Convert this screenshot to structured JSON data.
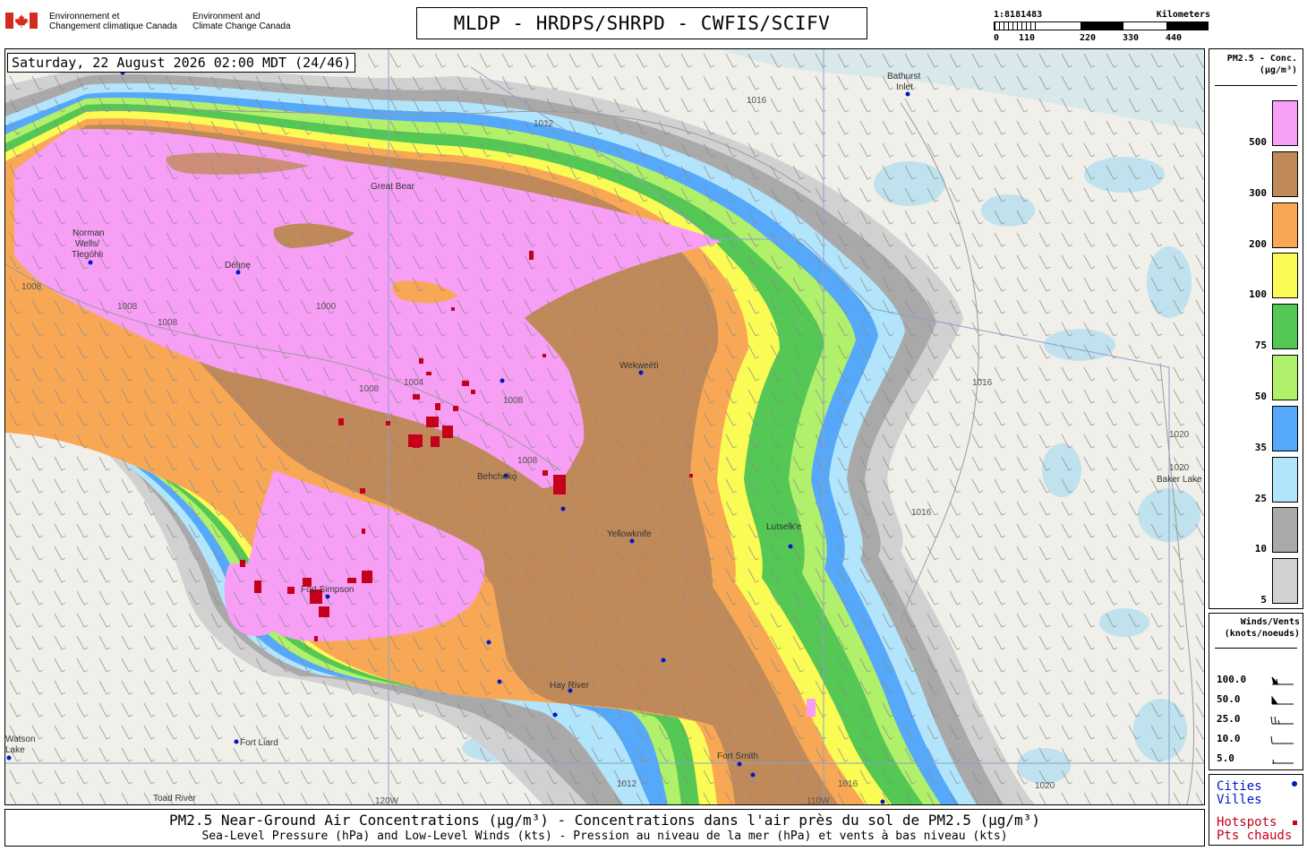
{
  "header": {
    "gov_fr_line1": "Environnement et",
    "gov_fr_line2": "Changement climatique Canada",
    "gov_en_line1": "Environment and",
    "gov_en_line2": "Climate Change Canada",
    "title": "MLDP - HRDPS/SHRPD - CWFIS/SCIFV"
  },
  "scale": {
    "ratio": "1:8181483",
    "unit": "Kilometers",
    "ticks": [
      "0",
      "110",
      "220",
      "330",
      "440"
    ]
  },
  "map": {
    "timestamp": "Saturday, 22 August 2026 02:00 MDT (24/46)",
    "places": [
      {
        "name": "Bathurst",
        "name2": "Inlet"
      },
      {
        "name": "Norman",
        "name2": "Wells/",
        "name3": "Tłegóhłı"
      },
      {
        "name": "Délı̨nę"
      },
      {
        "name": "Great Bear"
      },
      {
        "name": "Wekweètì"
      },
      {
        "name": "Yellowknife"
      },
      {
        "name": "Fort Simpson"
      },
      {
        "name": "Hay River"
      },
      {
        "name": "Fort Liard"
      },
      {
        "name": "Fort Smith"
      },
      {
        "name": "Toad River"
      },
      {
        "name": "Lutselk'e"
      },
      {
        "name": "Baker Lake"
      },
      {
        "name": "Watson",
        "name2": "Lake"
      },
      {
        "name": "Behchokǫ̀"
      }
    ],
    "isobars": [
      "1016",
      "1012",
      "1008",
      "1008",
      "1008",
      "1000",
      "1008",
      "1004",
      "1008",
      "1008",
      "1016",
      "1016",
      "1020",
      "1020",
      "1012",
      "1016",
      "1020"
    ],
    "meridians": [
      "120W",
      "110W"
    ],
    "colors": {
      "land": "#f1efe9",
      "water": "#bfe2ee",
      "hotspot": "#c4001a",
      "city_dot": "#0018c8"
    }
  },
  "legend_pm": {
    "title_line1": "PM2.5 - Conc.",
    "title_line2": "(µg/m³)",
    "levels": [
      {
        "label": "500",
        "color": "#f79ef5"
      },
      {
        "label": "300",
        "color": "#c08959"
      },
      {
        "label": "200",
        "color": "#f8a855"
      },
      {
        "label": "100",
        "color": "#fbfb55"
      },
      {
        "label": "75",
        "color": "#54c754"
      },
      {
        "label": "50",
        "color": "#b0f06a"
      },
      {
        "label": "35",
        "color": "#55a8fa"
      },
      {
        "label": "25",
        "color": "#b2e5fb"
      },
      {
        "label": "10",
        "color": "#a9a9a9"
      },
      {
        "label": "5",
        "color": "#d1d1d1"
      }
    ]
  },
  "legend_wind": {
    "title_line1": "Winds/Vents",
    "title_line2": "(knots/noeuds)",
    "rows": [
      "100.0",
      "50.0",
      "25.0",
      "10.0",
      "5.0"
    ]
  },
  "legend_points": {
    "cities_en": "Cities",
    "cities_fr": "Villes",
    "hotspots_en": "Hotspots",
    "hotspots_fr": "Pts chauds",
    "city_color": "#0018c8",
    "hotspot_color": "#c4001a"
  },
  "footer": {
    "line1": "PM2.5 Near-Ground Air Concentrations (µg/m³) - Concentrations dans l'air près du sol de PM2.5 (µg/m³)",
    "line2": "Sea-Level Pressure (hPa) and Low-Level Winds (kts) - Pression au niveau de la mer (hPa) et vents à bas niveau (kts)"
  }
}
